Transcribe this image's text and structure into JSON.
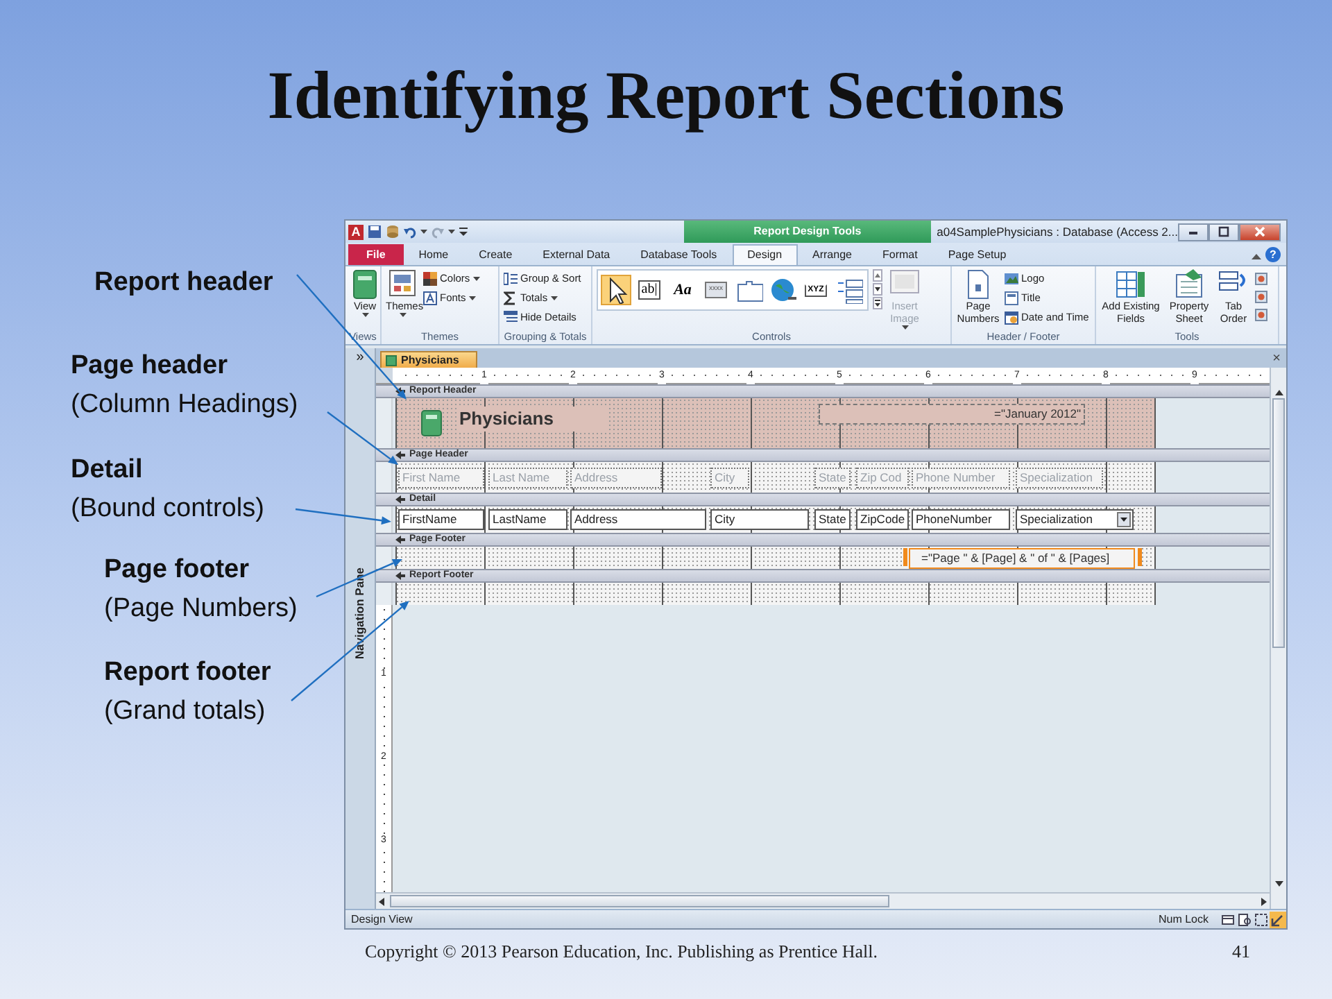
{
  "slide": {
    "title": "Identifying Report Sections",
    "callouts": [
      {
        "heading": "Report header"
      },
      {
        "heading": "Page header",
        "note": "(Column Headings)"
      },
      {
        "heading": "Detail",
        "note": "(Bound controls)"
      },
      {
        "heading": "Page footer",
        "note": "(Page Numbers)"
      },
      {
        "heading": "Report footer",
        "note": "(Grand totals)"
      }
    ],
    "copyright": "Copyright © 2013 Pearson Education, Inc. Publishing as Prentice Hall.",
    "page_number": "41"
  },
  "window": {
    "app_icon": "A",
    "contextual_tab": "Report Design Tools",
    "title": "a04SamplePhysicians : Database (Access 2...",
    "help": "?",
    "tabs": [
      {
        "label": "File",
        "kind": "file",
        "selected": false
      },
      {
        "label": "Home",
        "kind": "tab",
        "selected": false
      },
      {
        "label": "Create",
        "kind": "tab",
        "selected": false
      },
      {
        "label": "External Data",
        "kind": "tab",
        "selected": false
      },
      {
        "label": "Database Tools",
        "kind": "tab",
        "selected": false
      },
      {
        "label": "Design",
        "kind": "tab",
        "selected": true
      },
      {
        "label": "Arrange",
        "kind": "tab",
        "selected": false
      },
      {
        "label": "Format",
        "kind": "tab",
        "selected": false
      },
      {
        "label": "Page Setup",
        "kind": "tab",
        "selected": false
      }
    ],
    "ribbon": [
      {
        "label": "Views",
        "items": [
          {
            "kind": "view",
            "label": "View",
            "dropdown": true
          }
        ]
      },
      {
        "label": "Themes",
        "items": [
          {
            "kind": "themes",
            "label": "Themes",
            "dropdown": true
          },
          {
            "kind": "colors",
            "label": "Colors",
            "dropdown": true
          },
          {
            "kind": "fonts",
            "label": "Fonts",
            "dropdown": true
          }
        ]
      },
      {
        "label": "Grouping & Totals",
        "items": [
          {
            "kind": "group",
            "label": "Group & Sort"
          },
          {
            "kind": "totals",
            "label": "Totals",
            "dropdown": true
          },
          {
            "kind": "hide",
            "label": "Hide Details"
          }
        ]
      },
      {
        "label": "Controls",
        "items": [
          {
            "kind": "pointer",
            "selected": true
          },
          {
            "kind": "textbox",
            "text": "ab|",
            "selected": false
          },
          {
            "kind": "label",
            "text": "Aa",
            "selected": false
          },
          {
            "kind": "button",
            "text": "xxxx",
            "selected": false
          },
          {
            "kind": "tabctl",
            "selected": false
          },
          {
            "kind": "hyperlink",
            "selected": false
          },
          {
            "kind": "frame",
            "text": "XYZ",
            "selected": false
          },
          {
            "kind": "listbox",
            "selected": false
          },
          {
            "kind": "scroller"
          },
          {
            "kind": "image",
            "label": "Insert Image",
            "dropdown": true,
            "disabled": true
          }
        ]
      },
      {
        "label": "Header / Footer",
        "items": [
          {
            "kind": "pagenum",
            "label": "Page Numbers"
          },
          {
            "kind": "logo",
            "label": "Logo"
          },
          {
            "kind": "title",
            "label": "Title"
          },
          {
            "kind": "datetime",
            "label": "Date and Time"
          }
        ]
      },
      {
        "label": "Tools",
        "items": [
          {
            "kind": "fields",
            "label": "Add Existing Fields"
          },
          {
            "kind": "sheet",
            "label": "Property Sheet"
          },
          {
            "kind": "taborder",
            "label": "Tab Order"
          },
          {
            "kind": "tool"
          },
          {
            "kind": "tool"
          },
          {
            "kind": "tool"
          }
        ]
      }
    ],
    "nav_toggle": "»",
    "navigation_pane": "Navigation Pane",
    "document_tab": "Physicians",
    "close_document": "×",
    "ruler": [
      "1",
      "2",
      "3",
      "4",
      "5",
      "6",
      "7",
      "8",
      "9"
    ],
    "vertical_ruler": [
      "1",
      "2",
      "3"
    ],
    "sections": [
      {
        "label": "Report Header",
        "shaded": true,
        "controls": [
          {
            "kind": "logo"
          },
          {
            "kind": "title",
            "text": "Physicians"
          },
          {
            "kind": "expression",
            "text": "=\"January 2012\"",
            "selected": false
          }
        ]
      },
      {
        "label": "Page Header",
        "shaded": false,
        "controls": [
          {
            "kind": "label",
            "text": "First Name"
          },
          {
            "kind": "label",
            "text": "Last Name"
          },
          {
            "kind": "label",
            "text": "Address"
          },
          {
            "kind": "label",
            "text": "City"
          },
          {
            "kind": "label",
            "text": "State"
          },
          {
            "kind": "label",
            "text": "Zip Cod"
          },
          {
            "kind": "label",
            "text": "Phone Number"
          },
          {
            "kind": "label",
            "text": "Specialization"
          }
        ]
      },
      {
        "label": "Detail",
        "shaded": false,
        "controls": [
          {
            "kind": "textbox",
            "text": "FirstName"
          },
          {
            "kind": "textbox",
            "text": "LastName"
          },
          {
            "kind": "textbox",
            "text": "Address"
          },
          {
            "kind": "textbox",
            "text": "City"
          },
          {
            "kind": "textbox",
            "text": "State"
          },
          {
            "kind": "textbox",
            "text": "ZipCode"
          },
          {
            "kind": "textbox",
            "text": "PhoneNumber"
          },
          {
            "kind": "combo",
            "text": "Specialization"
          }
        ]
      },
      {
        "label": "Page Footer",
        "shaded": false,
        "controls": [
          {
            "kind": "expression",
            "text": "=\"Page \" & [Page] & \" of \" & [Pages]",
            "selected": true
          }
        ]
      },
      {
        "label": "Report Footer",
        "shaded": false
      }
    ],
    "status_bar": {
      "mode": "Design View",
      "indicator": "Num Lock",
      "views": [
        {
          "kind": "report",
          "selected": false
        },
        {
          "kind": "preview",
          "selected": false
        },
        {
          "kind": "layout",
          "selected": false
        },
        {
          "kind": "design",
          "selected": true
        }
      ]
    }
  }
}
